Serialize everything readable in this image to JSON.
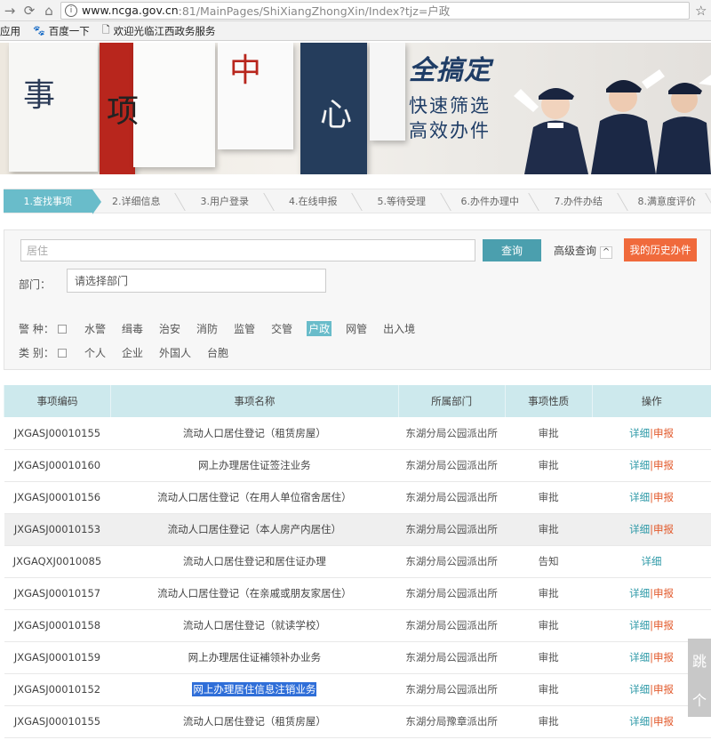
{
  "browser": {
    "url_host": "www.ncga.gov.cn",
    "url_rest": ":81/MainPages/ShiXiangZhongXin/Index?tjz=户政",
    "bookmarks": [
      "应用",
      "百度一下",
      "欢迎光临江西政务服务"
    ]
  },
  "banner": {
    "chars": [
      "事",
      "项",
      "中",
      "心"
    ],
    "slogan_main": "全搞定",
    "slogan_line1": "快速筛选",
    "slogan_line2": "高效办件"
  },
  "steps": [
    {
      "label": "1.查找事项",
      "active": true
    },
    {
      "label": "2.详细信息",
      "active": false
    },
    {
      "label": "3.用户登录",
      "active": false
    },
    {
      "label": "4.在线申报",
      "active": false
    },
    {
      "label": "5.等待受理",
      "active": false
    },
    {
      "label": "6.办件办理中",
      "active": false
    },
    {
      "label": "7.办件办结",
      "active": false
    },
    {
      "label": "8.满意度评价",
      "active": false
    }
  ],
  "search": {
    "value": "居住",
    "query_label": "查询",
    "advanced_label": "高级查询",
    "history_label": "我的历史办件",
    "dept_label": "部门：",
    "dept_placeholder": "请选择部门"
  },
  "filters": {
    "category_label": "警 种：",
    "categories": [
      "水警",
      "缉毒",
      "治安",
      "消防",
      "监管",
      "交管",
      "户政",
      "网管",
      "出入境"
    ],
    "active_category": "户政",
    "type_label": "类 别：",
    "types": [
      "个人",
      "企业",
      "外国人",
      "台胞"
    ]
  },
  "table": {
    "headers": [
      "事项编码",
      "事项名称",
      "所属部门",
      "事项性质",
      "操作"
    ],
    "detail_label": "详细",
    "apply_label": "申报",
    "sep": "|",
    "rows": [
      {
        "code": "JXGASJ00010155",
        "name": "流动人口居住登记（租赁房屋）",
        "dept": "东湖分局公园派出所",
        "nature": "审批",
        "apply": true
      },
      {
        "code": "JXGASJ00010160",
        "name": "网上办理居住证签注业务",
        "dept": "东湖分局公园派出所",
        "nature": "审批",
        "apply": true
      },
      {
        "code": "JXGASJ00010156",
        "name": "流动人口居住登记（在用人单位宿舍居住）",
        "dept": "东湖分局公园派出所",
        "nature": "审批",
        "apply": true
      },
      {
        "code": "JXGASJ00010153",
        "name": "流动人口居住登记（本人房产内居住）",
        "dept": "东湖分局公园派出所",
        "nature": "审批",
        "apply": true
      },
      {
        "code": "JXGAQXJ0010085",
        "name": "流动人口居住登记和居住证办理",
        "dept": "东湖分局公园派出所",
        "nature": "告知",
        "apply": false
      },
      {
        "code": "JXGASJ00010157",
        "name": "流动人口居住登记（在亲戚或朋友家居住）",
        "dept": "东湖分局公园派出所",
        "nature": "审批",
        "apply": true
      },
      {
        "code": "JXGASJ00010158",
        "name": "流动人口居住登记（就读学校）",
        "dept": "东湖分局公园派出所",
        "nature": "审批",
        "apply": true
      },
      {
        "code": "JXGASJ00010159",
        "name": "网上办理居住证補领补办业务",
        "dept": "东湖分局公园派出所",
        "nature": "审批",
        "apply": true
      },
      {
        "code": "JXGASJ00010152",
        "name": "网上办理居住信息注销业务",
        "dept": "东湖分局公园派出所",
        "nature": "审批",
        "apply": true
      },
      {
        "code": "JXGASJ00010155",
        "name": "流动人口居住登记（租赁房屋）",
        "dept": "东湖分局豫章派出所",
        "nature": "审批",
        "apply": true
      }
    ]
  },
  "side": {
    "btn1": "跳",
    "btn2": "个"
  }
}
